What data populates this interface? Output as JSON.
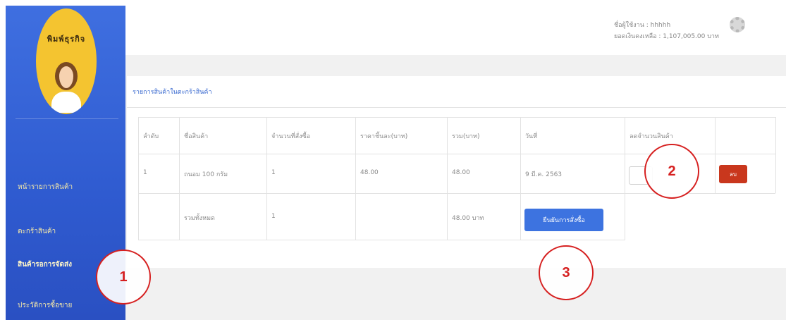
{
  "sidebar": {
    "logo_text": "พิมพ์ธุรกิจ",
    "items": [
      {
        "label": "หน้ารายการสินค้า",
        "active": false
      },
      {
        "label": "ตะกร้าสินค้า",
        "active": false
      },
      {
        "label": "สินค้ารอการจัดส่ง",
        "active": true
      },
      {
        "label": "ประวัติการซื้อขาย",
        "active": false
      }
    ]
  },
  "header": {
    "user_line": "ชื่อผู้ใช้งาน : hhhhh",
    "balance_line": "ยอดเงินคงเหลือ : 1,107,005.00 บาท",
    "settings_icon": "gear-icon"
  },
  "cart": {
    "title": "รายการสินค้าในตะกร้าสินค้า",
    "columns": [
      "ลำดับ",
      "ชื่อสินค้า",
      "จำนวนที่สั่งซื้อ",
      "ราคาชิ้นละ(บาท)",
      "รวม(บาท)",
      "วันที่",
      "ลดจำนวนสินค้า",
      ""
    ],
    "rows": [
      {
        "index": "1",
        "name": "ถนอม 100 กรัม",
        "qty": "1",
        "unit_price": "48.00",
        "total": "48.00",
        "date": "9 มี.ค. 2563"
      }
    ],
    "summary": {
      "label": "รวมทั้งหมด",
      "qty": "1",
      "total": "48.00 บาท"
    },
    "delete_label": "ลบ",
    "confirm_label": "ยืนยันการสั่งซื้อ"
  },
  "markers": [
    "1",
    "2",
    "3"
  ],
  "colors": {
    "sidebar": "#2f5bd0",
    "accent_button": "#3d73e0",
    "delete_button": "#c9371d",
    "marker": "#d62020"
  }
}
